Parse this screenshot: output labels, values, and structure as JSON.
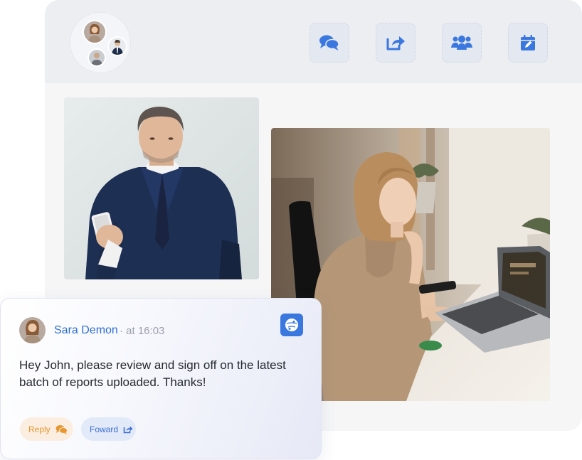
{
  "header": {
    "buttons": [
      {
        "icon": "chat-bubbles-icon",
        "name": "Messages"
      },
      {
        "icon": "share-icon",
        "name": "Share"
      },
      {
        "icon": "users-icon",
        "name": "Team"
      },
      {
        "icon": "calendar-edit-icon",
        "name": "Calendar"
      }
    ]
  },
  "message": {
    "sender": "Sara Demon",
    "time": "· at 16:03",
    "text": "Hey John, please review and sign off on the latest batch of reports uploaded. Thanks!",
    "reply_label": "Reply",
    "forward_label": "Foward"
  },
  "colors": {
    "accent": "#3a78e0",
    "reply": "#e8962e",
    "panel": "#f6f6f7",
    "header": "#eceef2"
  }
}
